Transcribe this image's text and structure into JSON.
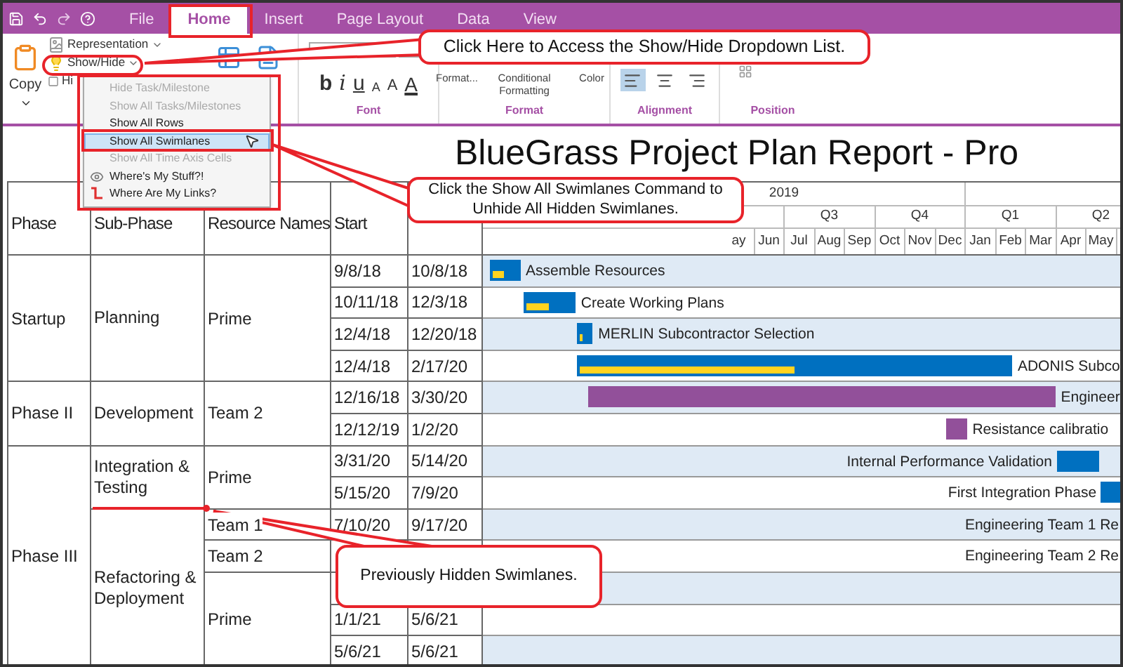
{
  "tabs": [
    {
      "label": "File",
      "selected": false
    },
    {
      "label": "Home",
      "selected": true
    },
    {
      "label": "Insert",
      "selected": false
    },
    {
      "label": "Page Layout",
      "selected": false
    },
    {
      "label": "Data",
      "selected": false
    },
    {
      "label": "View",
      "selected": false
    }
  ],
  "ribbon": {
    "copy_label": "Copy",
    "commands": [
      {
        "label": "Representation",
        "kind": "representation"
      },
      {
        "label": "Show/Hide",
        "kind": "showhide"
      },
      {
        "label": "Hi",
        "kind": "hide"
      }
    ],
    "font": {
      "buttons": [
        "b",
        "i",
        "u",
        "A",
        "A",
        "A"
      ],
      "group": "Font"
    },
    "format": {
      "buttons": [
        "Format...",
        "Conditional Formatting",
        "Color"
      ],
      "group": "Format"
    },
    "alignment": {
      "buttons": [
        {
          "kind": "left",
          "selected": true
        },
        {
          "kind": "center",
          "selected": false
        },
        {
          "kind": "right",
          "selected": false
        }
      ],
      "group": "Alignment"
    },
    "position": {
      "group": "Position"
    }
  },
  "menu": {
    "items": [
      {
        "label": "Hide Task/Milestone",
        "kind": "plain",
        "disabled": true,
        "selected": false
      },
      {
        "label": "Show All Tasks/Milestones",
        "kind": "plain",
        "disabled": true,
        "selected": false
      },
      {
        "label": "Show All Rows",
        "kind": "plain",
        "disabled": false,
        "selected": false
      },
      {
        "label": "Show All Swimlanes",
        "kind": "plain",
        "disabled": false,
        "selected": true
      },
      {
        "label": "Show All Time Axis Cells",
        "kind": "plain",
        "disabled": true,
        "selected": false
      },
      {
        "label": "Where's My Stuff?!",
        "kind": "stuff",
        "disabled": false,
        "selected": false
      },
      {
        "label": "Where Are My Links?",
        "kind": "links",
        "disabled": false,
        "selected": false
      }
    ]
  },
  "document": {
    "title": "BlueGrass Project Plan Report - Pro"
  },
  "table": {
    "columns": [
      "Phase",
      "Sub-Phase",
      "Resource Names",
      "Start"
    ],
    "timeline": {
      "years": [
        "2019"
      ],
      "quarters": [
        "Q3",
        "Q4",
        "Q1",
        "Q2"
      ],
      "months": [
        "ay",
        "Jun",
        "Jul",
        "Aug",
        "Sep",
        "Oct",
        "Nov",
        "Dec",
        "Jan",
        "Feb",
        "Mar",
        "Apr",
        "May"
      ]
    },
    "phases": [
      {
        "name": "Startup",
        "subphases": [
          {
            "name": "Planning",
            "resources": [
              {
                "name": "Prime",
                "tasks": [
                  {
                    "start": "9/8/18",
                    "finish": "10/8/18",
                    "shaded": true,
                    "bar": {
                      "label": "Assemble Resources",
                      "kind": "trailing",
                      "color": "#0070c0",
                      "level": 0.45
                    }
                  },
                  {
                    "start": "10/11/18",
                    "finish": "12/3/18",
                    "shaded": false,
                    "bar": {
                      "label": "Create Working Plans",
                      "kind": "trailing",
                      "color": "#0070c0",
                      "level": 0.5
                    }
                  },
                  {
                    "start": "12/4/18",
                    "finish": "12/20/18",
                    "shaded": true,
                    "bar": {
                      "label": "MERLIN Subcontractor Selection",
                      "kind": "trailing",
                      "color": "#0070c0",
                      "level": 0.3
                    }
                  },
                  {
                    "start": "12/4/18",
                    "finish": "2/17/20",
                    "shaded": false,
                    "bar": {
                      "label": "ADONIS Subco",
                      "kind": "trailing",
                      "color": "#0070c0",
                      "level": 0.5
                    }
                  }
                ]
              }
            ]
          }
        ]
      },
      {
        "name": "Phase II",
        "subphases": [
          {
            "name": "Development",
            "resources": [
              {
                "name": "Team 2",
                "tasks": [
                  {
                    "start": "12/16/18",
                    "finish": "3/30/20",
                    "shaded": true,
                    "bar": {
                      "label": "Engineer",
                      "kind": "trailing",
                      "color": "#92509a"
                    }
                  },
                  {
                    "start": "12/12/19",
                    "finish": "1/2/20",
                    "shaded": false,
                    "bar": {
                      "label": "Resistance calibratio",
                      "kind": "trailing",
                      "color": "#92509a"
                    }
                  }
                ]
              }
            ]
          }
        ]
      },
      {
        "name": "Phase III",
        "subphases": [
          {
            "name": "Integration & Testing",
            "resources": [
              {
                "name": "Prime",
                "tasks": [
                  {
                    "start": "3/31/20",
                    "finish": "5/14/20",
                    "shaded": true,
                    "bar": {
                      "label": "Internal Performance Validation",
                      "kind": "leading",
                      "color": "#0070c0"
                    }
                  },
                  {
                    "start": "5/15/20",
                    "finish": "7/9/20",
                    "shaded": false,
                    "bar": {
                      "label": "First Integration Phase",
                      "kind": "leading",
                      "color": "#0070c0"
                    }
                  }
                ]
              }
            ]
          },
          {
            "name": "Refactoring & Deployment",
            "resources": [
              {
                "name": "Team 1",
                "tasks": [
                  {
                    "start": "7/10/20",
                    "finish": "9/17/20",
                    "shaded": true,
                    "bar": {
                      "label": "Engineering Team 1 Re",
                      "kind": "leading"
                    }
                  }
                ]
              },
              {
                "name": "Team 2",
                "tasks": [
                  {
                    "shaded": false,
                    "bar": {
                      "label": "Engineering Team 2 Re",
                      "kind": "leading"
                    }
                  }
                ]
              },
              {
                "name": "Prime",
                "tasks": [
                  {
                    "shaded": true
                  },
                  {
                    "start": "1/1/21",
                    "finish": "5/6/21",
                    "shaded": false
                  },
                  {
                    "start": "5/6/21",
                    "finish": "5/6/21",
                    "shaded": true
                  }
                ]
              }
            ]
          }
        ]
      }
    ]
  },
  "callouts": [
    {
      "text": "Click Here to Access the Show/Hide Dropdown List."
    },
    {
      "text": "Click the Show All Swimlanes Command to Unhide All Hidden Swimlanes."
    },
    {
      "text": "Previously Hidden Swimlanes."
    }
  ]
}
